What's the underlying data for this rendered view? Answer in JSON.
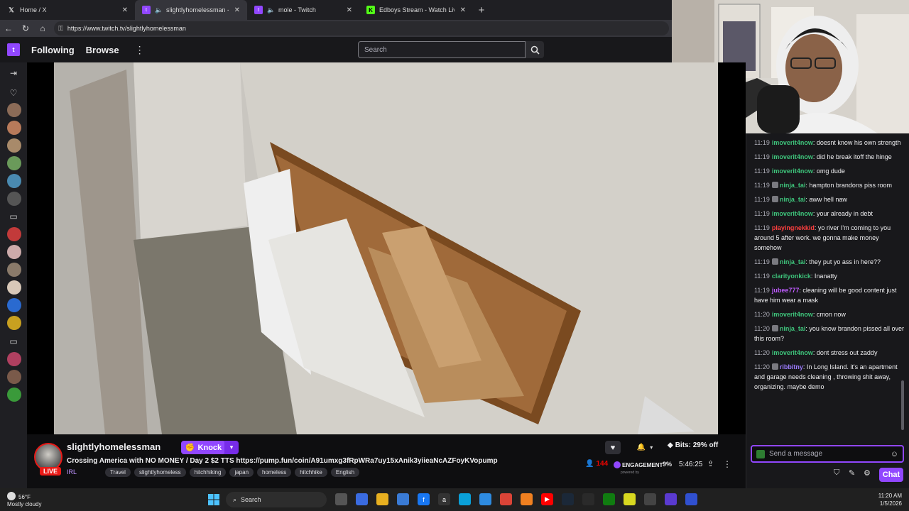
{
  "browser": {
    "tabs": [
      {
        "label": "Home / X",
        "icon": "x-logo"
      },
      {
        "label": "slightlyhomelessman - Twitch",
        "icon": "twitch-logo",
        "muted": true,
        "active": true
      },
      {
        "label": "mole - Twitch",
        "icon": "twitch-logo",
        "muted": true
      },
      {
        "label": "Edboys Stream - Watch Live o",
        "icon": "kick-logo"
      }
    ],
    "url": "https://www.twitch.tv/slightlyhomelessman"
  },
  "topnav": {
    "following": "Following",
    "browse": "Browse",
    "search_placeholder": "Search"
  },
  "stream": {
    "channel": "slightlyhomelessman",
    "knock_label": "Knock",
    "title": "Crossing America with NO MONEY / Day 2 $2 TTS https://pump.fun/coin/A91umxg3fRpWRa7uy15xAnik3yiieaNcAZFoyKVopump",
    "category": "IRL",
    "tags": [
      "Travel",
      "slightlyhomeless",
      "hitchhiking",
      "japan",
      "homeless",
      "hitchhike",
      "English"
    ],
    "live": "LIVE",
    "bits": "Bits: 29% off",
    "viewers": "144",
    "engagement_label": "ENGAGEMENT",
    "engagement_sub": "powered by",
    "engagement_pct": "9%",
    "uptime": "5:46:25"
  },
  "chat": {
    "messages": [
      {
        "time": "11:19",
        "user": "imoverit4now",
        "color": "#3ec47b",
        "text": "doesnt know his own strength"
      },
      {
        "time": "11:19",
        "user": "imoverit4now",
        "color": "#3ec47b",
        "text": "did he break itoff the hinge"
      },
      {
        "time": "11:19",
        "user": "imoverit4now",
        "color": "#3ec47b",
        "text": "omg dude"
      },
      {
        "time": "11:19",
        "user": "ninja_tai",
        "color": "#3ec47b",
        "badge": true,
        "text": "hampton brandons piss room"
      },
      {
        "time": "11:19",
        "user": "ninja_tai",
        "color": "#3ec47b",
        "badge": true,
        "text": "aww hell naw"
      },
      {
        "time": "11:19",
        "user": "imoverit4now",
        "color": "#3ec47b",
        "text": "your already in debt"
      },
      {
        "time": "11:19",
        "user": "playingnekkid",
        "color": "#ff3f3f",
        "text": "yo river I'm coming to you around 5 after work. we gonna make money somehow"
      },
      {
        "time": "11:19",
        "user": "ninja_tai",
        "color": "#3ec47b",
        "badge": true,
        "text": "they put yo ass in here??"
      },
      {
        "time": "11:19",
        "user": "clarityonkick",
        "color": "#3ec47b",
        "text": "Inanatty"
      },
      {
        "time": "11:19",
        "user": "jubee777",
        "color": "#bf5cff",
        "text": "cleaning will be good content just have him wear a mask"
      },
      {
        "time": "11:20",
        "user": "imoverit4now",
        "color": "#3ec47b",
        "text": "cmon now"
      },
      {
        "time": "11:20",
        "user": "ninja_tai",
        "color": "#3ec47b",
        "badge": true,
        "text": "you know brandon pissed all over this room?"
      },
      {
        "time": "11:20",
        "user": "imoverit4now",
        "color": "#3ec47b",
        "text": "dont stress out zaddy"
      },
      {
        "time": "11:20",
        "user": "ribbitny",
        "color": "#9c7bff",
        "badge": true,
        "text": "In Long Island. it's an apartment and garage needs cleaning , throwing shit away, organizing. maybe demo"
      }
    ],
    "input_placeholder": "Send a message",
    "send_label": "Chat"
  },
  "taskbar": {
    "temp": "56°F",
    "weather": "Mostly cloudy",
    "search": "Search",
    "time": "11:20 AM",
    "date": "1/5/2026"
  }
}
